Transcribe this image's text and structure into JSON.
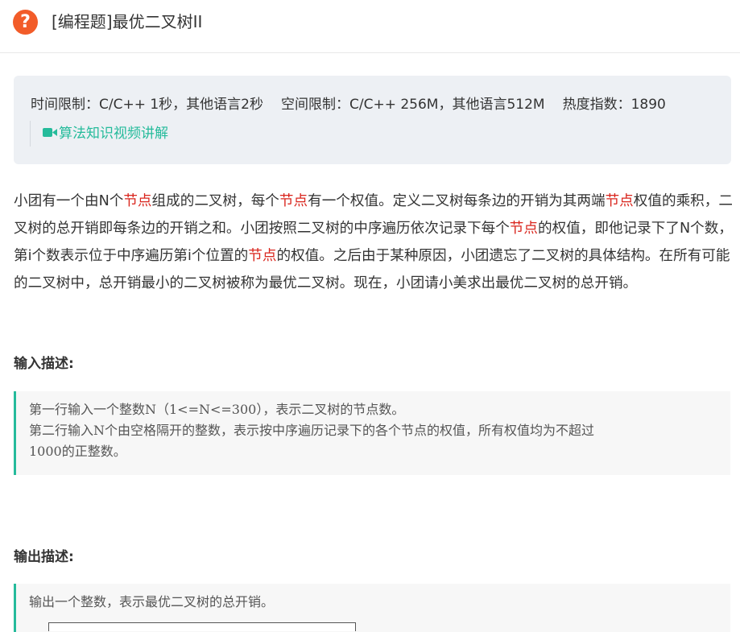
{
  "header": {
    "icon": "question-mark-icon",
    "icon_color": "#f25c29",
    "title": "[编程题]最优二叉树II"
  },
  "info": {
    "time_limit": "时间限制：C/C++ 1秒，其他语言2秒",
    "space_limit": "空间限制：C/C++ 256M，其他语言512M",
    "heat": "热度指数：1890",
    "video_icon": "video-camera-icon",
    "video_link": "算法知识视频讲解",
    "accent_color": "#25bb9b"
  },
  "description": {
    "segments": [
      {
        "t": "小团有一个由N个"
      },
      {
        "t": "节点",
        "kw": true
      },
      {
        "t": "组成的二叉树，每个"
      },
      {
        "t": "节点",
        "kw": true
      },
      {
        "t": "有一个权值。定义二叉树每条边的开销为其两端"
      },
      {
        "t": "节点",
        "kw": true
      },
      {
        "t": "权值的乘积，二叉树的总开销即每条边的开销之和。小团按照二叉树的中序遍历依次记录下每个"
      },
      {
        "t": "节点",
        "kw": true
      },
      {
        "t": "的权值，即他记录下了N个数，第i个数表示位于中序遍历第i个位置的"
      },
      {
        "t": "节点",
        "kw": true
      },
      {
        "t": "的权值。之后由于某种原因，小团遗忘了二叉树的具体结构。在所有可能的二叉树中，总开销最小的二叉树被称为最优二叉树。现在，小团请小美求出最优二叉树的总开销。"
      }
    ],
    "keyword_color": "#d9251d"
  },
  "input_section": {
    "title": "输入描述:",
    "lines": [
      "第一行输入一个整数N（1<=N<=300），表示二叉树的节点数。",
      "第二行输入N个由空格隔开的整数，表示按中序遍历记录下的各个节点的权值，所有权值均为不超过",
      "1000的正整数。"
    ]
  },
  "output_section": {
    "title": "输出描述:",
    "lines": [
      "输出一个整数，表示最优二叉树的总开销。"
    ]
  }
}
